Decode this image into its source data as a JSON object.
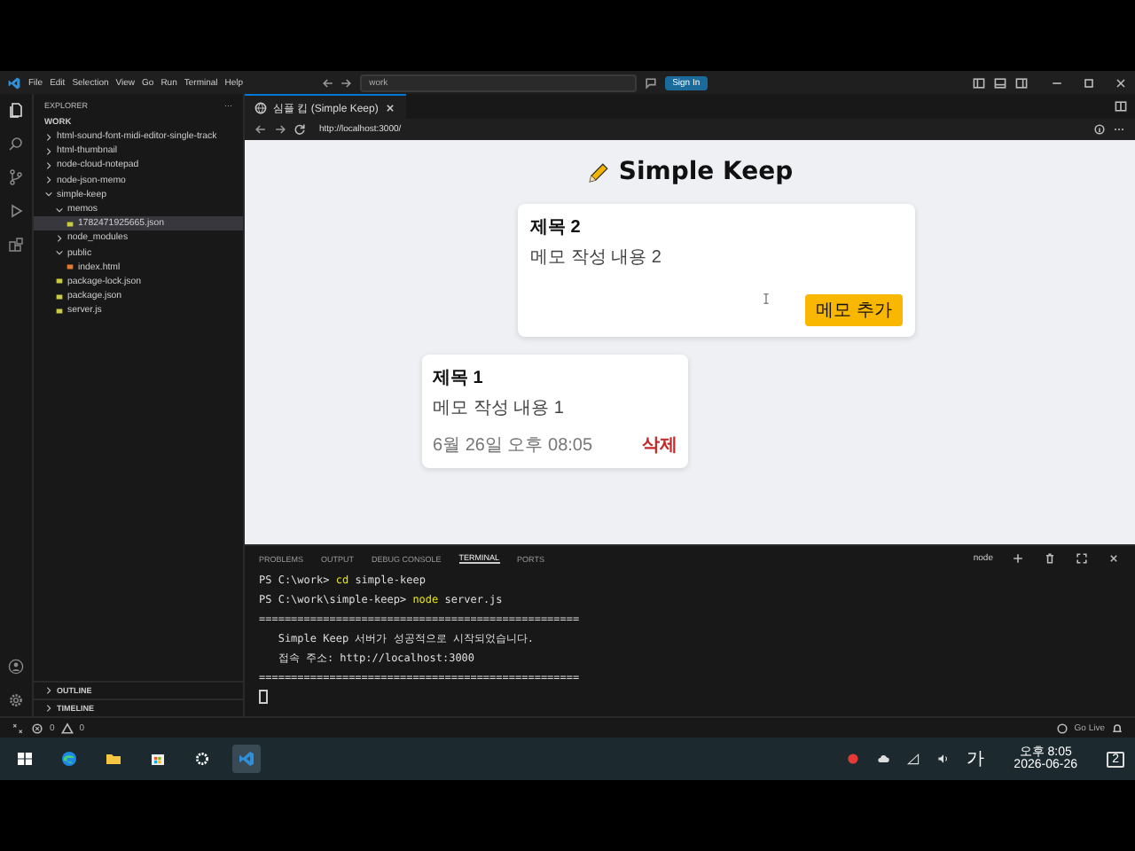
{
  "title_bar": {
    "menu": [
      "File",
      "Edit",
      "Selection",
      "View",
      "Go",
      "Run",
      "Terminal",
      "Help"
    ],
    "search": "work",
    "sign_in": "Sign In"
  },
  "explorer": {
    "title": "EXPLORER",
    "more": "···",
    "root": "WORK",
    "tree": [
      {
        "label": "html-sound-font-midi-editor-single-track",
        "kind": "folder",
        "expanded": false,
        "selected": false
      },
      {
        "label": "html-thumbnail",
        "kind": "folder",
        "expanded": false,
        "selected": false
      },
      {
        "label": "node-cloud-notepad",
        "kind": "folder",
        "expanded": false,
        "selected": false
      },
      {
        "label": "node-json-memo",
        "kind": "folder",
        "expanded": false,
        "selected": false
      },
      {
        "label": "simple-keep",
        "kind": "folder",
        "expanded": true,
        "selected": false,
        "children": [
          {
            "label": "memos",
            "kind": "folder",
            "expanded": true,
            "selected": false,
            "children": [
              {
                "label": "1782471925665.json",
                "kind": "json",
                "selected": true
              }
            ]
          },
          {
            "label": "node_modules",
            "kind": "folder",
            "expanded": false,
            "selected": false
          },
          {
            "label": "public",
            "kind": "folder",
            "expanded": true,
            "selected": false,
            "children": [
              {
                "label": "index.html",
                "kind": "html",
                "selected": false
              }
            ]
          },
          {
            "label": "package-lock.json",
            "kind": "json",
            "selected": false
          },
          {
            "label": "package.json",
            "kind": "json",
            "selected": false
          },
          {
            "label": "server.js",
            "kind": "js",
            "selected": false
          }
        ]
      }
    ],
    "sections": [
      "OUTLINE",
      "TIMELINE"
    ]
  },
  "browser": {
    "tab": "심플 킵 (Simple Keep)",
    "url": "http://localhost:3000/"
  },
  "page": {
    "title": "Simple Keep",
    "editor": {
      "title": "제목 2",
      "body": "메모 작성 내용 2",
      "button": "메모 추가"
    },
    "memos": [
      {
        "title": "제목 1",
        "body": "메모 작성 내용 1",
        "date": "6월 26일 오후 08:05",
        "delete": "삭제"
      }
    ]
  },
  "panel": {
    "tabs": [
      {
        "label": "PROBLEMS",
        "selected": false
      },
      {
        "label": "OUTPUT",
        "selected": false
      },
      {
        "label": "DEBUG CONSOLE",
        "selected": false
      },
      {
        "label": "TERMINAL",
        "selected": true
      },
      {
        "label": "PORTS",
        "selected": false
      }
    ],
    "shell": "node",
    "lines": [
      {
        "kind": "command",
        "prompt": "PS C:\\work>",
        "command": "cd",
        "args": "simple-keep"
      },
      {
        "kind": "command",
        "prompt": "PS C:\\work\\simple-keep>",
        "command": "node",
        "args": "server.js"
      },
      {
        "kind": "output",
        "text": "=================================================="
      },
      {
        "kind": "output",
        "text": "   Simple Keep 서버가 성공적으로 시작되었습니다."
      },
      {
        "kind": "output",
        "text": "   접속 주소: http://localhost:3000"
      },
      {
        "kind": "output",
        "text": "=================================================="
      }
    ]
  },
  "status_bar": {
    "errors": "0",
    "warnings": "0",
    "go_live": "Go Live"
  },
  "taskbar": {
    "ime": "가",
    "time": "오후 8:05",
    "date": "2026-06-26",
    "notifications": "2"
  }
}
